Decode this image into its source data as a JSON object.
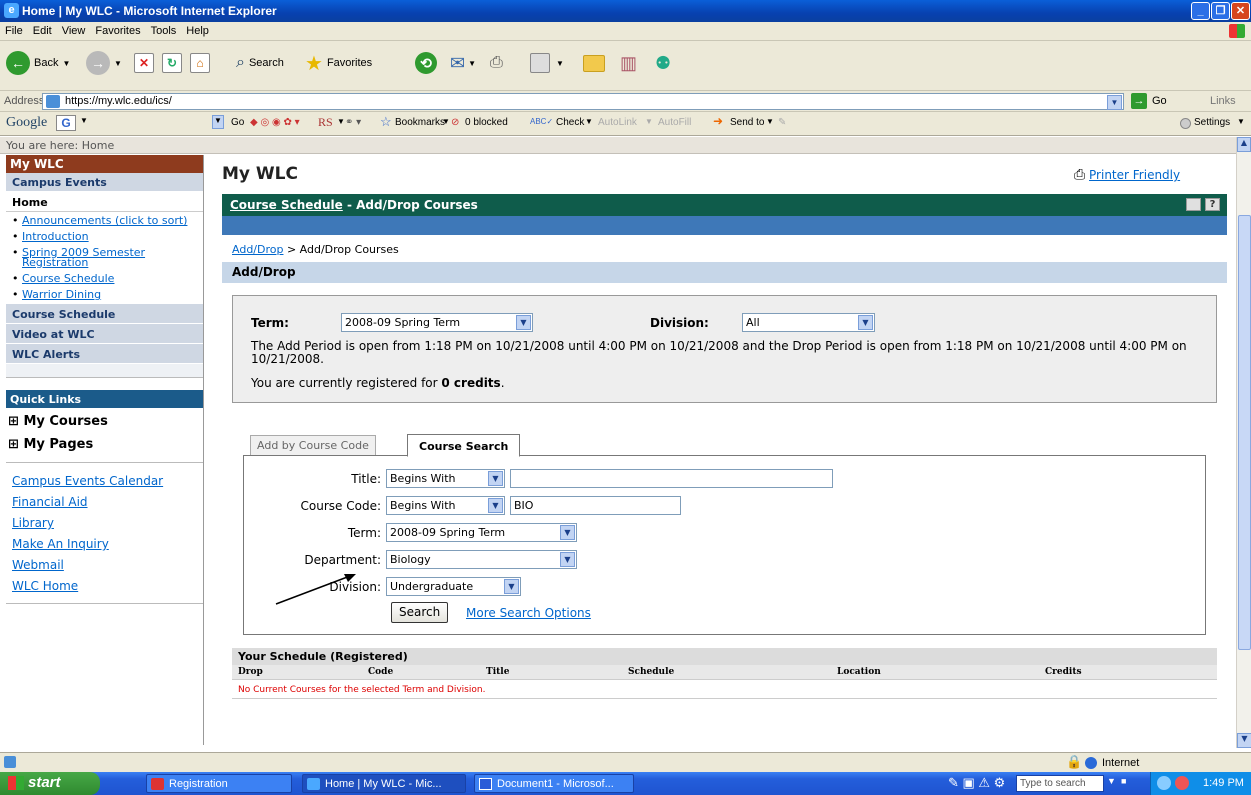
{
  "window": {
    "title": "Home | My WLC - Microsoft Internet Explorer"
  },
  "menu": [
    "File",
    "Edit",
    "View",
    "Favorites",
    "Tools",
    "Help"
  ],
  "toolbar": {
    "back": "Back",
    "search": "Search",
    "favorites": "Favorites"
  },
  "address": {
    "label": "Address",
    "url": "https://my.wlc.edu/ics/",
    "go": "Go",
    "links": "Links"
  },
  "googlebar": {
    "logo": "Google",
    "g": "G",
    "go": "Go",
    "rs": "RS",
    "bookmarks": "Bookmarks",
    "blocked": "0 blocked",
    "check": "Check",
    "autolink": "AutoLink",
    "autofill": "AutoFill",
    "sendto": "Send to",
    "settings": "Settings"
  },
  "crumb": "You are here:  Home",
  "sidebar": {
    "title": "My WLC",
    "sections": {
      "campus_events": "Campus Events",
      "home": "Home",
      "course_schedule": "Course Schedule",
      "video": "Video at WLC",
      "alerts": "WLC Alerts"
    },
    "home_links": [
      "Announcements (click to sort)",
      "Introduction",
      "Spring 2009 Semester Registration",
      "Course Schedule",
      "Warrior Dining"
    ],
    "quick_links_title": "Quick Links",
    "my_courses": "My Courses",
    "my_pages": "My Pages",
    "quick_links": [
      "Campus Events Calendar",
      "Financial Aid",
      "Library",
      "Make An Inquiry",
      "Webmail",
      "WLC Home"
    ]
  },
  "main": {
    "title": "My WLC",
    "printer": "Printer Friendly",
    "header_link": "Course Schedule",
    "header_rest": " - Add/Drop Courses",
    "breadcrumb_link": "Add/Drop",
    "breadcrumb_rest": " > Add/Drop Courses",
    "section_title": "Add/Drop",
    "term_label": "Term:",
    "term_value": "2008-09 Spring Term",
    "division_label": "Division:",
    "division_value": "All",
    "period_text": "The Add Period is open from 1:18 PM on 10/21/2008 until 4:00 PM on 10/21/2008 and the Drop Period is open from 1:18 PM on 10/21/2008 until 4:00 PM on 10/21/2008.",
    "registered_prefix": "You are currently registered for ",
    "registered_credits": "0 credits",
    "registered_suffix": ".",
    "tabs": {
      "add_by_code": "Add by Course Code",
      "course_search": "Course Search"
    },
    "form": {
      "title_label": "Title:",
      "title_mode": "Begins With",
      "title_value": "",
      "code_label": "Course Code:",
      "code_mode": "Begins With",
      "code_value": "BIO",
      "term_label": "Term:",
      "term_value": "2008-09 Spring Term",
      "dept_label": "Department:",
      "dept_value": "Biology",
      "div_label": "Division:",
      "div_value": "Undergraduate",
      "search_button": "Search",
      "more_options": "More Search Options"
    },
    "schedule": {
      "title": "Your Schedule (Registered)",
      "columns": [
        "Drop",
        "Code",
        "Title",
        "Schedule",
        "Location",
        "Credits"
      ],
      "empty_message": "No Current Courses for the selected Term and Division."
    }
  },
  "status": {
    "zone": "Internet"
  },
  "taskbar": {
    "start": "start",
    "tasks": [
      "Registration",
      "Home | My WLC - Mic...",
      "Document1 - Microsof..."
    ],
    "search_placeholder": "Type to search",
    "clock": "1:49 PM"
  }
}
